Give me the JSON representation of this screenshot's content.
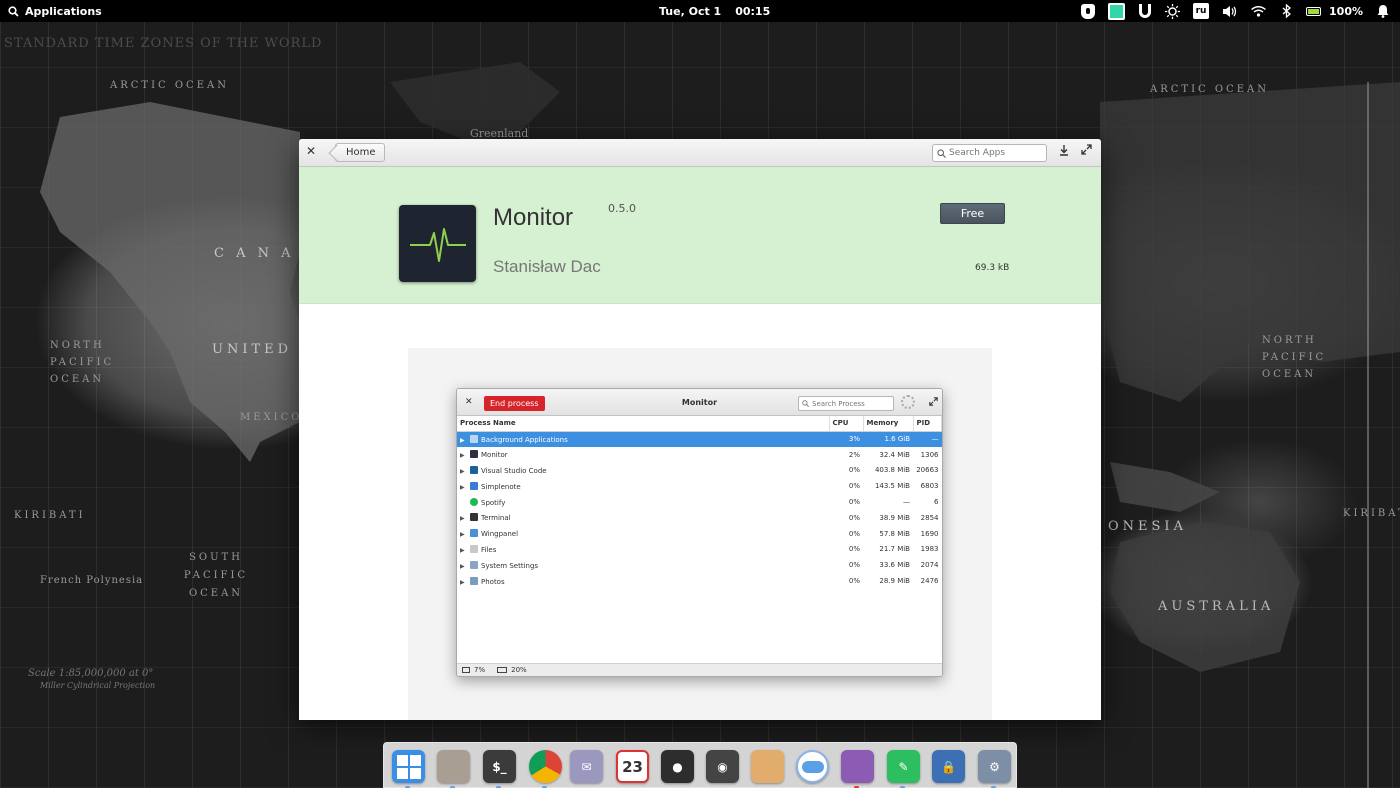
{
  "top_panel": {
    "applications_label": "Applications",
    "date": "Tue, Oct 1",
    "time": "00:15",
    "keyboard_layout": "ru",
    "battery_percent": "100%"
  },
  "wallpaper": {
    "title": "STANDARD TIME ZONES OF THE WORLD",
    "labels": {
      "arctic_ocean": "ARCTIC OCEAN",
      "arctic_ocean_right": "ARCTIC OCEAN",
      "greenland": "Greenland",
      "canada": "C A N A D A",
      "united_states": "UNITED ST",
      "mexico": "MEXICO",
      "north_pacific_ocean": "NORTH PACIFIC OCEAN",
      "north_pacific_ocean_right": "NORTH PACIFIC OCEAN",
      "south_pacific_ocean": "SOUTH PACIFIC OCEAN",
      "kiribati": "KIRIBATI",
      "kiribati_right": "KIRIBATI",
      "french_polynesia": "French Polynesia",
      "australia": "AUSTRALIA",
      "indonesia": "ONESIA",
      "scale_text": "Scale 1:85,000,000 at 0°",
      "projection_text": "Miller Cylindrical Projection"
    }
  },
  "appcenter": {
    "home_label": "Home",
    "search_placeholder": "Search Apps",
    "app_name": "Monitor",
    "app_version": "0.5.0",
    "app_author": "Stanisław Dac",
    "price_button": "Free",
    "download_size": "69.3 kB",
    "accent_banner_color": "#d6f1d1"
  },
  "monitor_screenshot": {
    "title": "Monitor",
    "end_process_label": "End process",
    "search_placeholder": "Search Process",
    "columns": [
      "Process Name",
      "CPU",
      "Memory",
      "PID"
    ],
    "rows": [
      {
        "name": "Background Applications",
        "cpu": "3%",
        "memory": "1.6 GiB",
        "pid": "—",
        "expandable": true,
        "icon_color": "#bcd6f2"
      },
      {
        "name": "Monitor",
        "cpu": "2%",
        "memory": "32.4 MiB",
        "pid": "1306",
        "expandable": true,
        "icon_color": "#2b3340"
      },
      {
        "name": "Visual Studio Code",
        "cpu": "0%",
        "memory": "403.8 MiB",
        "pid": "20663",
        "expandable": true,
        "icon_color": "#1e5f9e"
      },
      {
        "name": "Simplenote",
        "cpu": "0%",
        "memory": "143.5 MiB",
        "pid": "6803",
        "expandable": true,
        "icon_color": "#3a7bd5"
      },
      {
        "name": "Spotify",
        "cpu": "0%",
        "memory": "—",
        "pid": "6",
        "expandable": false,
        "icon_color": "#1db954"
      },
      {
        "name": "Terminal",
        "cpu": "0%",
        "memory": "38.9 MiB",
        "pid": "2854",
        "expandable": true,
        "icon_color": "#333333"
      },
      {
        "name": "Wingpanel",
        "cpu": "0%",
        "memory": "57.8 MiB",
        "pid": "1690",
        "expandable": true,
        "icon_color": "#4a90d9"
      },
      {
        "name": "Files",
        "cpu": "0%",
        "memory": "21.7 MiB",
        "pid": "1983",
        "expandable": true,
        "icon_color": "#c8c8c8"
      },
      {
        "name": "System Settings",
        "cpu": "0%",
        "memory": "33.6 MiB",
        "pid": "2074",
        "expandable": true,
        "icon_color": "#8aa4c8"
      },
      {
        "name": "Photos",
        "cpu": "0%",
        "memory": "28.9 MiB",
        "pid": "2476",
        "expandable": true,
        "icon_color": "#7a9cc0"
      }
    ],
    "status_cpu": "7%",
    "status_memory": "20%"
  },
  "dock": {
    "calendar_day": "23",
    "items": [
      {
        "name": "multitasking-view",
        "color": "#3a8ee6"
      },
      {
        "name": "files",
        "color": "#a89f92"
      },
      {
        "name": "terminal",
        "color": "#3b3b3b"
      },
      {
        "name": "chrome",
        "color": "#e8e8e8"
      },
      {
        "name": "mail",
        "color": "#9b98c0"
      },
      {
        "name": "calendar",
        "color": "#ffffff"
      },
      {
        "name": "music",
        "color": "#2d2d2d"
      },
      {
        "name": "videos",
        "color": "#444444"
      },
      {
        "name": "photos",
        "color": "#e2ad6c"
      },
      {
        "name": "settings-toggle",
        "color": "#5aa0e6"
      },
      {
        "name": "appcenter",
        "color": "#8c5bb3"
      },
      {
        "name": "evernote",
        "color": "#2dbe60"
      },
      {
        "name": "keepassxc",
        "color": "#3d6fb4"
      },
      {
        "name": "system-settings",
        "color": "#7d8fa6"
      }
    ]
  }
}
